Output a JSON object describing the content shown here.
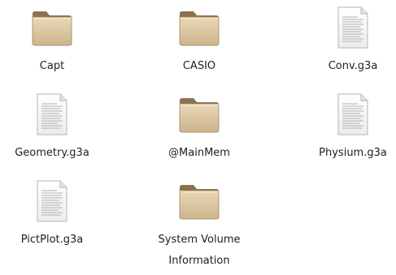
{
  "files": [
    {
      "name": "Capt",
      "type": "folder",
      "icon": "folder-icon"
    },
    {
      "name": "CASIO",
      "type": "folder",
      "icon": "folder-icon"
    },
    {
      "name": "Conv.g3a",
      "type": "file",
      "icon": "document-icon"
    },
    {
      "name": "Geometry.g3a",
      "type": "file",
      "icon": "document-icon"
    },
    {
      "name": "@MainMem",
      "type": "folder",
      "icon": "folder-icon"
    },
    {
      "name": "Physium.g3a",
      "type": "file",
      "icon": "document-icon"
    },
    {
      "name": "PictPlot.g3a",
      "type": "file",
      "icon": "document-icon"
    },
    {
      "name": "System Volume Information",
      "type": "folder",
      "icon": "folder-icon"
    }
  ]
}
